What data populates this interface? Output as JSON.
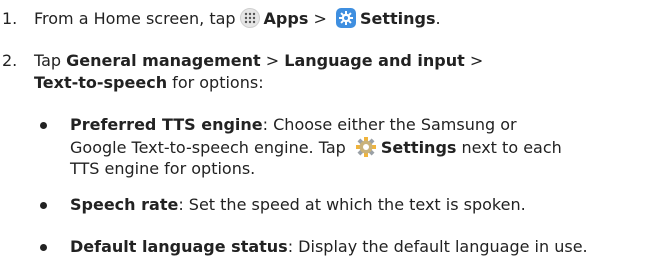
{
  "step1": {
    "number": "1.",
    "text_before": "From a Home screen, tap",
    "apps_label": "Apps",
    "separator": " > ",
    "settings_label": "Settings",
    "period": "."
  },
  "step2": {
    "number": "2.",
    "text_before": "Tap ",
    "general_management": "General management",
    "separator1": " > ",
    "language_and_input": "Language and input",
    "separator2": " >",
    "text_to_speech": "Text-to-speech",
    "text_after": " for options:"
  },
  "bullets": {
    "preferred": {
      "term": "Preferred TTS engine",
      "line1": ": Choose either the Samsung or",
      "line2_before": "Google Text-to-speech engine. Tap ",
      "settings_label": "Settings",
      "line2_after": " next to each",
      "line3": "TTS engine for options."
    },
    "speech_rate": {
      "term": "Speech rate",
      "text": ": Set the speed at which the text is spoken."
    },
    "default_language": {
      "term": "Default language status",
      "text": ": Display the default language in use."
    }
  },
  "icons": {
    "apps": "apps-grid-icon",
    "settings_app": "settings-app-icon",
    "gear": "gear-icon"
  },
  "colors": {
    "text": "#222222",
    "settings_app_blue": "#3f8fe0",
    "gear_yellow": "#f0b43c",
    "gear_gray": "#9aa0a6"
  }
}
